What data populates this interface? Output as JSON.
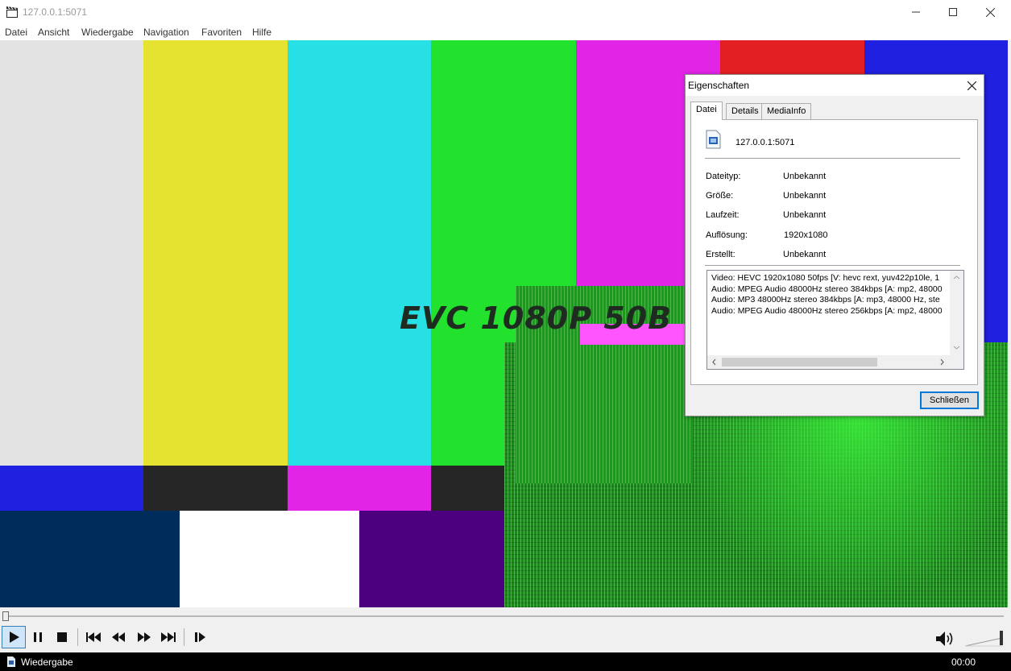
{
  "window": {
    "title": "127.0.0.1:5071",
    "icon": "clapperboard-icon",
    "controls": [
      "minimize-icon",
      "maximize-icon",
      "close-icon"
    ]
  },
  "menu": [
    "Datei",
    "Ansicht",
    "Wiedergabe",
    "Navigation",
    "Favoriten",
    "Hilfe"
  ],
  "video": {
    "overlay_text": "EVC 1080P 50B",
    "colors": {
      "top_bars": [
        "#e3e3e3",
        "#e5e330",
        "#27e0e5",
        "#22e22d",
        "#e124e6",
        "#e31f24",
        "#2020e0"
      ],
      "middle_bars": [
        "#2020e0",
        "#262626",
        "#e124e6",
        "#262626"
      ],
      "bottom_bars": [
        "#002c5c",
        "#ffffff",
        "#4c0080"
      ],
      "corruption": "#178a17"
    }
  },
  "seek": {
    "position": 0.0
  },
  "toolbar": {
    "buttons": [
      "play-icon",
      "pause-icon",
      "stop-icon",
      "previous-icon",
      "rewind-icon",
      "fast-forward-icon",
      "next-icon",
      "frame-step-icon"
    ],
    "volume_icon": "speaker-icon"
  },
  "status": {
    "text": "Wiedergabe",
    "time": "00:00"
  },
  "dialog": {
    "title": "Eigenschaften",
    "tabs": [
      "Datei",
      "Details",
      "MediaInfo"
    ],
    "active_tab": "Datei",
    "file_name": "127.0.0.1:5071",
    "properties": [
      {
        "label": "Dateityp:",
        "value": "Unbekannt"
      },
      {
        "label": "Größe:",
        "value": "Unbekannt"
      },
      {
        "label": "Laufzeit:",
        "value": "Unbekannt"
      },
      {
        "label": "Auflösung:",
        "value": "1920x1080"
      },
      {
        "label": "Erstellt:",
        "value": "Unbekannt"
      }
    ],
    "streams": [
      "Video: HEVC 1920x1080 50fps [V: hevc rext, yuv422p10le, 1",
      "Audio: MPEG Audio 48000Hz stereo 384kbps [A: mp2, 48000",
      "Audio: MP3 48000Hz stereo 384kbps [A: mp3, 48000 Hz, ste",
      "Audio: MPEG Audio 48000Hz stereo 256kbps [A: mp2, 48000"
    ],
    "close_label": "Schließen"
  }
}
